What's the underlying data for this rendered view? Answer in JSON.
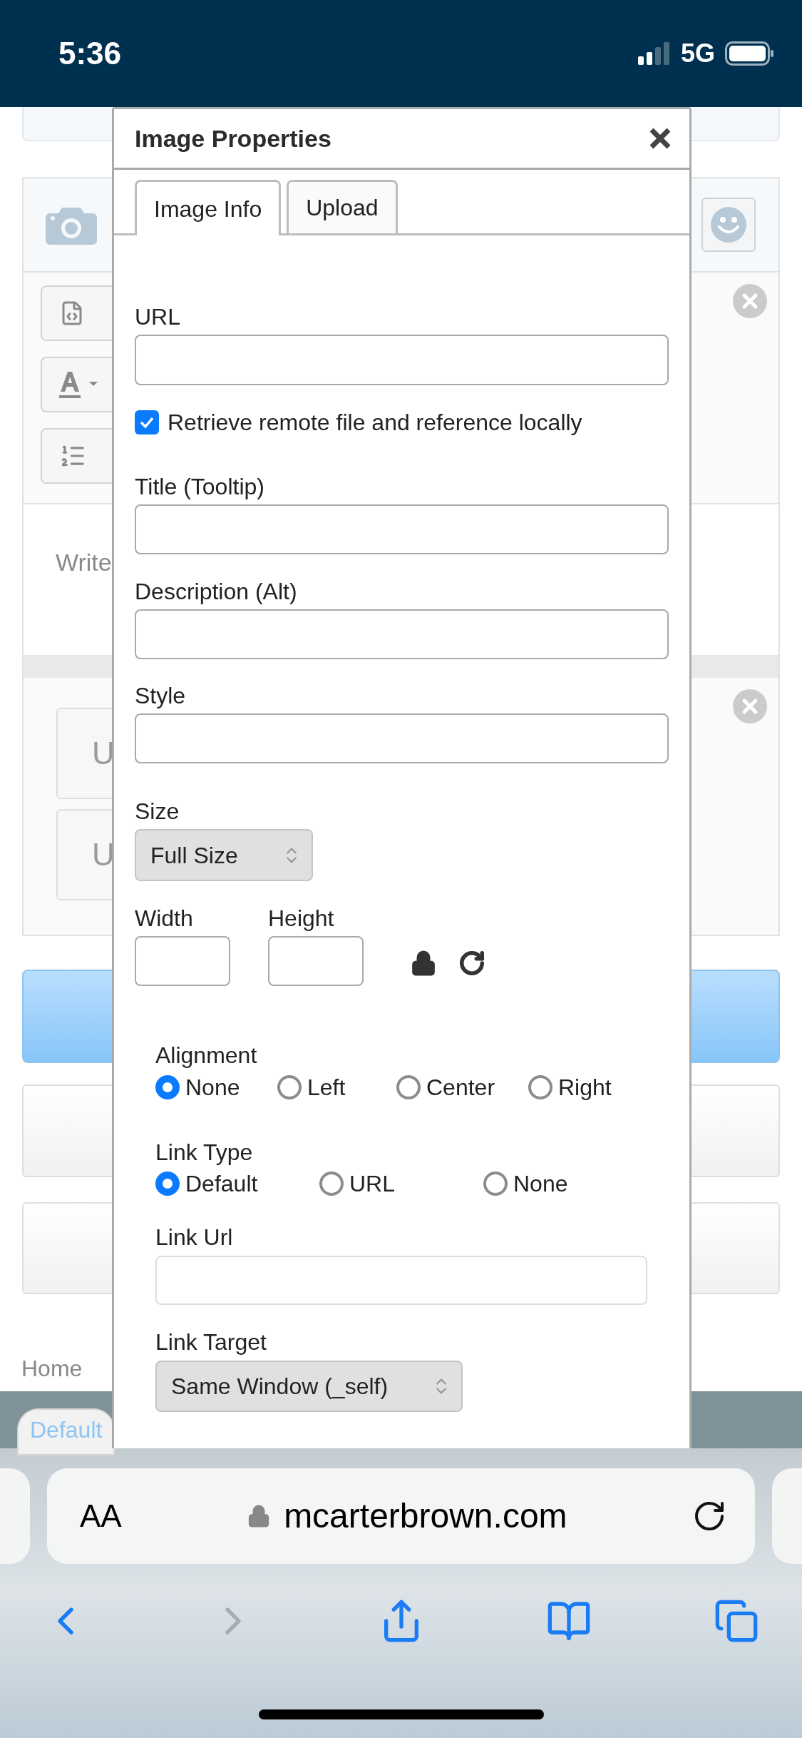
{
  "status_bar": {
    "time": "5:36",
    "network": "5G"
  },
  "page": {
    "editor_placeholder": "Write",
    "upload_buttons": [
      "U",
      "U"
    ],
    "breadcrumb": "Home",
    "style_pill": "Default"
  },
  "dialog": {
    "title": "Image Properties",
    "tabs": [
      {
        "label": "Image Info",
        "selected": true
      },
      {
        "label": "Upload",
        "selected": false
      }
    ],
    "url": {
      "label": "URL"
    },
    "retrieve_remote": {
      "label": "Retrieve remote file and reference locally",
      "checked": true
    },
    "title_field": {
      "label": "Title (Tooltip)"
    },
    "description": {
      "label": "Description (Alt)"
    },
    "style": {
      "label": "Style"
    },
    "size": {
      "label": "Size",
      "value": "Full Size"
    },
    "width": {
      "label": "Width"
    },
    "height": {
      "label": "Height"
    },
    "alignment": {
      "label": "Alignment",
      "options": [
        {
          "label": "None",
          "selected": true
        },
        {
          "label": "Left",
          "selected": false
        },
        {
          "label": "Center",
          "selected": false
        },
        {
          "label": "Right",
          "selected": false
        }
      ]
    },
    "link_type": {
      "label": "Link Type",
      "options": [
        {
          "label": "Default",
          "selected": true
        },
        {
          "label": "URL",
          "selected": false
        },
        {
          "label": "None",
          "selected": false
        }
      ]
    },
    "link_url": {
      "label": "Link Url"
    },
    "link_target": {
      "label": "Link Target",
      "value": "Same Window (_self)"
    }
  },
  "browser": {
    "text_size_button": "AA",
    "address": "mcarterbrown.com"
  }
}
